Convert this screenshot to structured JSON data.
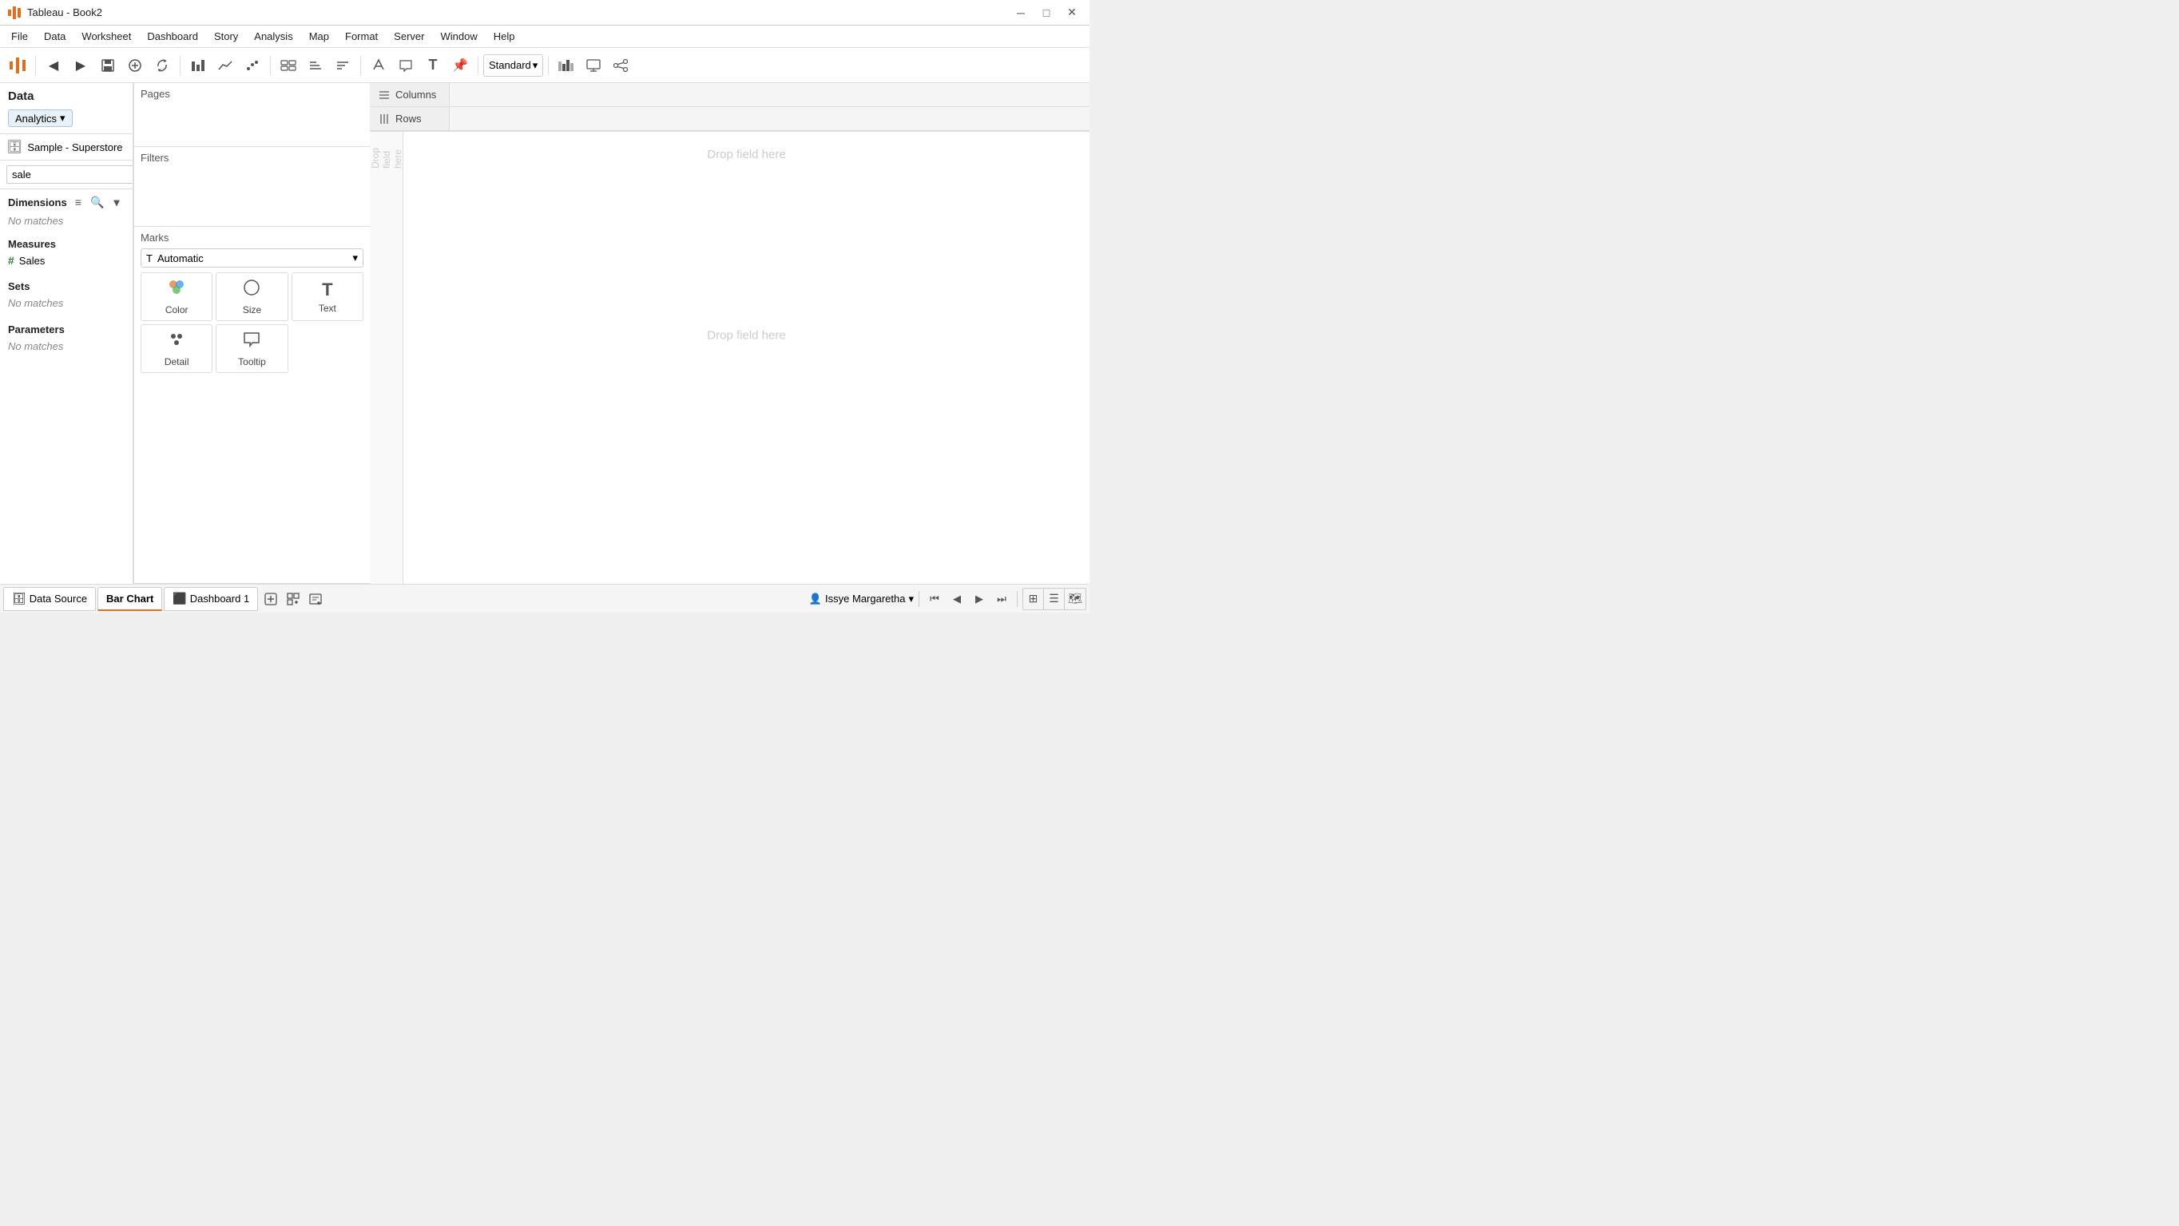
{
  "app": {
    "title": "Tableau - Book2",
    "icon": "📊"
  },
  "titlebar": {
    "title": "Tableau - Book2",
    "minimize": "─",
    "maximize": "□",
    "close": "✕"
  },
  "menubar": {
    "items": [
      "File",
      "Data",
      "Worksheet",
      "Dashboard",
      "Story",
      "Analysis",
      "Map",
      "Format",
      "Server",
      "Window",
      "Help"
    ]
  },
  "toolbar": {
    "standard_label": "Standard",
    "dropdown_arrow": "▾"
  },
  "left_panel": {
    "data_label": "Data",
    "analytics_label": "Analytics",
    "datasource": "Sample - Superstore",
    "search_placeholder": "sale",
    "search_value": "sale",
    "dimensions_label": "Dimensions",
    "no_matches_dimensions": "No matches",
    "measures_label": "Measures",
    "sales_field": "Sales",
    "sets_label": "Sets",
    "no_matches_sets": "No matches",
    "parameters_label": "Parameters",
    "no_matches_parameters": "No matches"
  },
  "columns_rows": {
    "columns_label": "Columns",
    "rows_label": "Rows",
    "columns_icon": "≡",
    "rows_icon": "≡"
  },
  "canvas": {
    "drop_field_top": "Drop field here",
    "drop_field_left": "Drop\nfield\nhere",
    "drop_field_center": "Drop field here"
  },
  "pages_section": {
    "title": "Pages"
  },
  "filters_section": {
    "title": "Filters"
  },
  "marks_section": {
    "title": "Marks",
    "type_label": "Automatic",
    "color_label": "Color",
    "size_label": "Size",
    "text_label": "Text",
    "detail_label": "Detail",
    "tooltip_label": "Tooltip"
  },
  "statusbar": {
    "datasource_tab": "Data Source",
    "barchart_tab": "Bar Chart",
    "dashboard_tab": "Dashboard 1",
    "add_sheet_tooltip": "New worksheet",
    "add_dashboard_tooltip": "New dashboard",
    "add_story_tooltip": "New story",
    "user_name": "Issye Margaretha"
  }
}
